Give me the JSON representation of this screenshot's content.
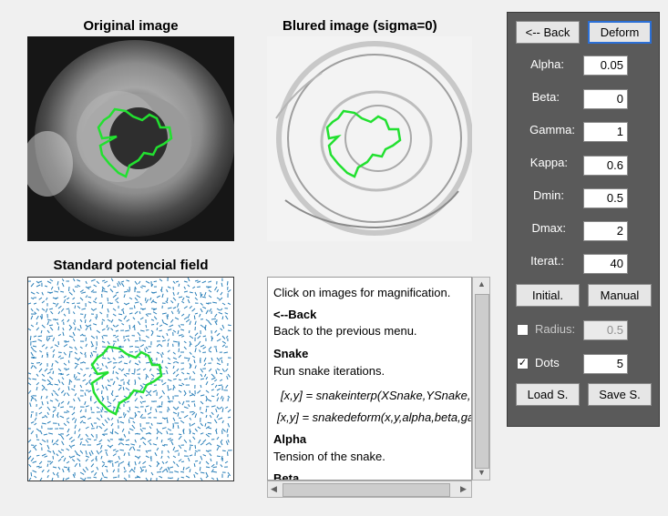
{
  "images": {
    "original_title": "Original image",
    "blurred_title": "Blured image   (sigma=0)",
    "field_title": "Standard potencial field"
  },
  "panel": {
    "back_label": "<-- Back",
    "deform_label": "Deform",
    "params": [
      {
        "label": "Alpha:",
        "value": "0.05"
      },
      {
        "label": "Beta:",
        "value": "0"
      },
      {
        "label": "Gamma:",
        "value": "1"
      },
      {
        "label": "Kappa:",
        "value": "0.6"
      },
      {
        "label": "Dmin:",
        "value": "0.5"
      },
      {
        "label": "Dmax:",
        "value": "2"
      },
      {
        "label": "Iterat.:",
        "value": "40"
      }
    ],
    "initial_label": "Initial.",
    "manual_label": "Manual",
    "radius_label": "Radius:",
    "radius_value": "0.5",
    "radius_checked": false,
    "dots_label": "Dots",
    "dots_value": "5",
    "dots_checked": true,
    "load_label": "Load S.",
    "save_label": "Save S."
  },
  "help": {
    "lines": [
      "Click on images for magnification.",
      "<--Back",
      "Back to the previous menu.",
      "Snake",
      "Run snake iterations.",
      "[x,y] = snakeinterp(XSnake,YSnake,dmax,",
      "[x,y] = snakedeform(x,y,alpha,beta,gamma",
      "Alpha",
      "Tension of the snake.",
      "Beta"
    ]
  },
  "colors": {
    "contour": "#22e030",
    "panel_bg": "#5a5a5a",
    "field_arrows": "#2a7fb8"
  }
}
